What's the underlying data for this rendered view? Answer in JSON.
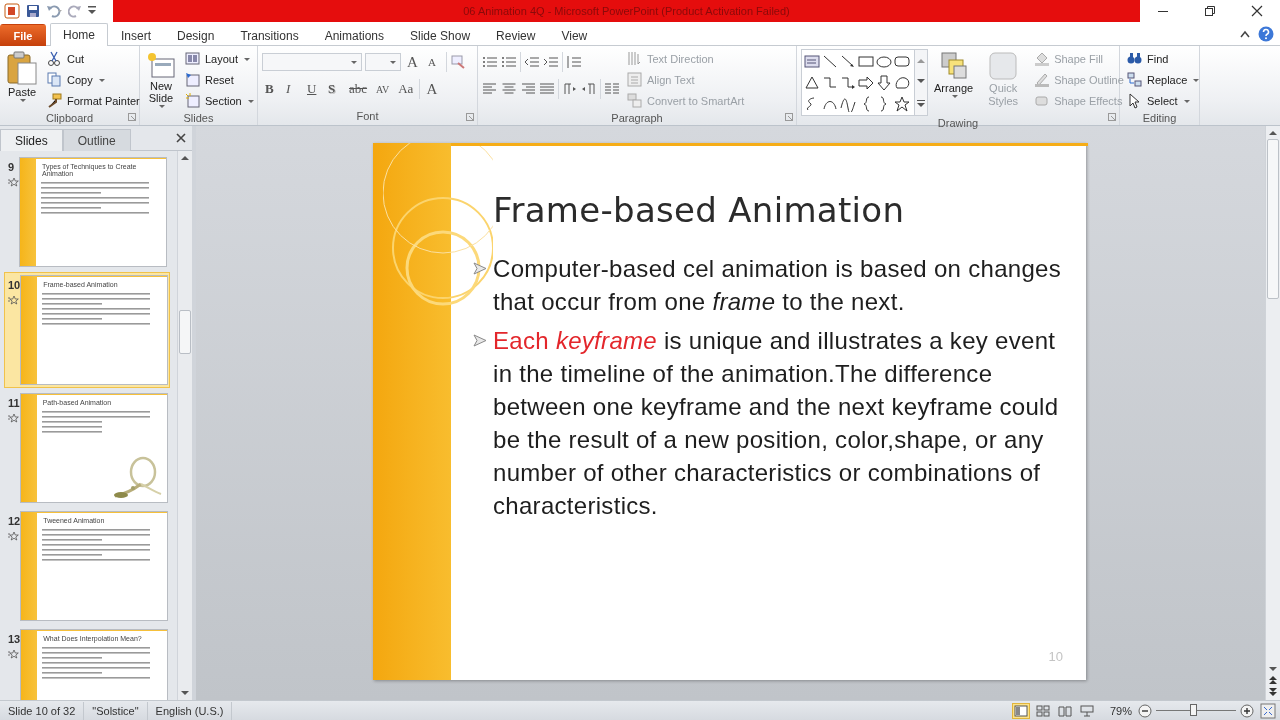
{
  "window": {
    "title": "06 Animation 4Q  -  Microsoft PowerPoint (Product Activation Failed)"
  },
  "ribbon_tabs": [
    {
      "label": "File",
      "kind": "file",
      "selected": false
    },
    {
      "label": "Home",
      "kind": "tab",
      "selected": true
    },
    {
      "label": "Insert",
      "kind": "tab",
      "selected": false
    },
    {
      "label": "Design",
      "kind": "tab",
      "selected": false
    },
    {
      "label": "Transitions",
      "kind": "tab",
      "selected": false
    },
    {
      "label": "Animations",
      "kind": "tab",
      "selected": false
    },
    {
      "label": "Slide Show",
      "kind": "tab",
      "selected": false
    },
    {
      "label": "Review",
      "kind": "tab",
      "selected": false
    },
    {
      "label": "View",
      "kind": "tab",
      "selected": false
    }
  ],
  "clipboard": {
    "label": "Clipboard",
    "paste": "Paste",
    "items": [
      {
        "label": "Cut",
        "kind": "cut",
        "dropdown": false
      },
      {
        "label": "Copy",
        "kind": "copy",
        "dropdown": true
      },
      {
        "label": "Format Painter",
        "kind": "painter",
        "dropdown": false
      }
    ]
  },
  "slides_group": {
    "label": "Slides",
    "new_slide": "New Slide",
    "items": [
      {
        "label": "Layout",
        "kind": "layout",
        "dropdown": true
      },
      {
        "label": "Reset",
        "kind": "reset",
        "dropdown": false
      },
      {
        "label": "Section",
        "kind": "section",
        "dropdown": true
      }
    ]
  },
  "font_group": {
    "label": "Font",
    "size_buttons": [
      {
        "label": "A",
        "kind": "grow"
      },
      {
        "label": "A",
        "kind": "shrink"
      }
    ],
    "style_buttons": [
      {
        "label": "B",
        "kind": "bold"
      },
      {
        "label": "I",
        "kind": "italic"
      },
      {
        "label": "U",
        "kind": "underline"
      },
      {
        "label": "S",
        "kind": "shadow"
      },
      {
        "label": "abc",
        "kind": "strike"
      },
      {
        "label": "AV",
        "kind": "spacing"
      },
      {
        "label": "Aa",
        "kind": "case"
      },
      {
        "label": "A",
        "kind": "color"
      }
    ]
  },
  "paragraph": {
    "label": "Paragraph",
    "items": [
      {
        "label": "Text Direction",
        "kind": "direction",
        "disabled": true
      },
      {
        "label": "Align Text",
        "kind": "align",
        "disabled": true
      },
      {
        "label": "Convert to SmartArt",
        "kind": "smartart",
        "disabled": true
      }
    ]
  },
  "drawing": {
    "label": "Drawing",
    "arrange": "Arrange",
    "quick_styles": {
      "label": "Quick Styles",
      "disabled": true
    },
    "items": [
      {
        "label": "Shape Fill",
        "kind": "fill",
        "disabled": true
      },
      {
        "label": "Shape Outline",
        "kind": "outline",
        "disabled": true
      },
      {
        "label": "Shape Effects",
        "kind": "effects",
        "disabled": true
      }
    ]
  },
  "editing": {
    "label": "Editing",
    "items": [
      {
        "label": "Find",
        "kind": "find",
        "dropdown": false
      },
      {
        "label": "Replace",
        "kind": "replace",
        "dropdown": true
      },
      {
        "label": "Select",
        "kind": "select",
        "dropdown": true
      }
    ]
  },
  "pane_tabs": [
    {
      "label": "Slides",
      "selected": true
    },
    {
      "label": "Outline",
      "selected": false
    }
  ],
  "thumbnails": [
    {
      "number": "9",
      "selected": false,
      "title": "Types of Techniques to Create Animation"
    },
    {
      "number": "10",
      "selected": true,
      "title": "Frame-based Animation"
    },
    {
      "number": "11",
      "selected": false,
      "title": "Path-based Animation"
    },
    {
      "number": "12",
      "selected": false,
      "title": "Tweened Animation"
    },
    {
      "number": "13",
      "selected": false,
      "title": "What Does Interpolation Mean?"
    }
  ],
  "slide": {
    "title": "Frame-based Animation",
    "bullets": [
      {
        "text": "Computer-based cel animation is based on changes that occur from one *frame* to the next."
      },
      {
        "highlight": "Each *keyframe*",
        "text": " is unique and illustrates a key event in the timeline of the animation.The difference between one keyframe and the next keyframe could be the result of a new position, color,shape, or any number of other characteristics or combinations of characteristics."
      }
    ],
    "page_number": "10"
  },
  "status_bar": {
    "slide": "Slide 10 of 32",
    "theme": "\"Solstice\"",
    "language": "English (U.S.)",
    "views": [
      {
        "kind": "normal",
        "selected": true
      },
      {
        "kind": "sorter",
        "selected": false
      },
      {
        "kind": "reading",
        "selected": false
      },
      {
        "kind": "show",
        "selected": false
      }
    ],
    "zoom": "79%",
    "zoom_slider": {
      "level": 0.46
    }
  }
}
